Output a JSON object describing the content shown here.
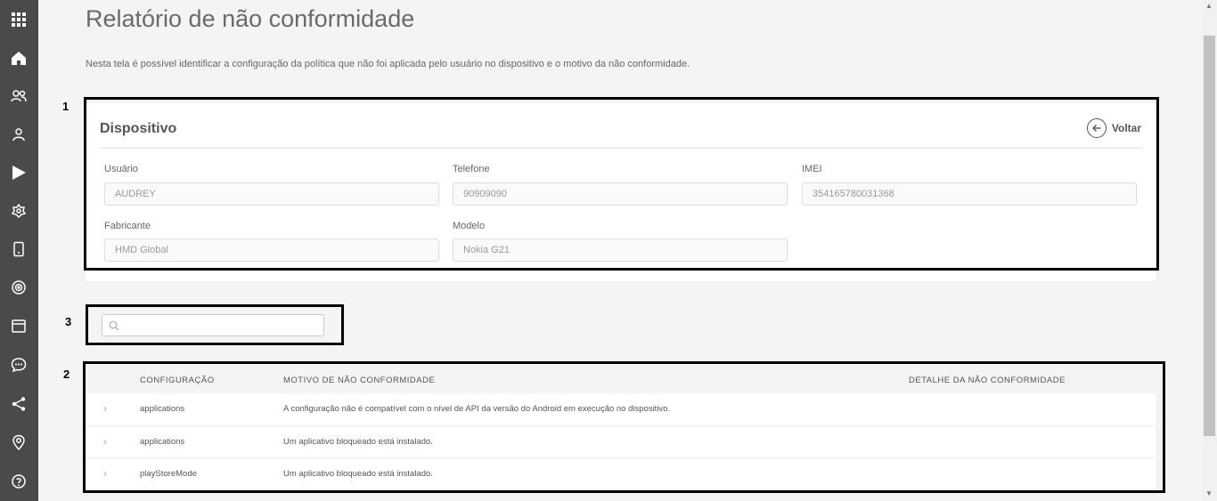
{
  "sidebar": {
    "icons": [
      "apps-grid-icon",
      "home-icon",
      "users-group-icon",
      "user-icon",
      "play-store-icon",
      "settings-flower-icon",
      "device-icon",
      "target-icon",
      "calendar-icon",
      "chat-icon",
      "share-icon",
      "location-icon",
      "help-icon"
    ]
  },
  "page": {
    "title": "Relatório de não conformidade",
    "description": "Nesta tela é possível identificar a configuração da política que não foi aplicada pelo usuário no dispositivo e o motivo da não conformidade."
  },
  "annotations": {
    "one": "1",
    "two": "2",
    "three": "3"
  },
  "device": {
    "title": "Dispositivo",
    "back_label": "Voltar",
    "fields": {
      "user_label": "Usuário",
      "user_value": "AUDREY",
      "phone_label": "Telefone",
      "phone_value": "90909090",
      "imei_label": "IMEI",
      "imei_value": "354165780031368",
      "maker_label": "Fabricante",
      "maker_value": "HMD Global",
      "model_label": "Modelo",
      "model_value": "Nokia G21"
    }
  },
  "search": {
    "placeholder": ""
  },
  "table": {
    "headers": [
      "CONFIGURAÇÃO",
      "MOTIVO DE NÃO CONFORMIDADE",
      "DETALHE DA NÃO CONFORMIDADE"
    ],
    "rows": [
      {
        "config": "applications",
        "reason": "A configuração não é compatível com o nível de API da versão do Android em execução no dispositivo.",
        "detail": ""
      },
      {
        "config": "applications",
        "reason": "Um aplicativo bloqueado está instalado.",
        "detail": ""
      },
      {
        "config": "playStoreMode",
        "reason": "Um aplicativo bloqueado está instalado.",
        "detail": ""
      }
    ],
    "chevron": "›"
  }
}
